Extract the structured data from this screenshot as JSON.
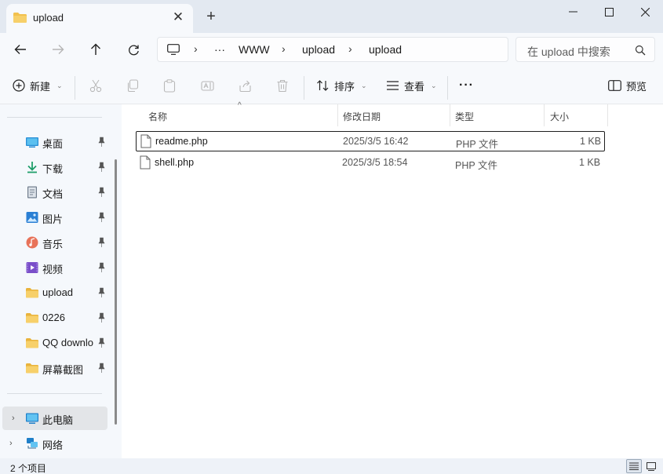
{
  "tab": {
    "title": "upload",
    "close_glyph": "✕",
    "new_glyph": "+"
  },
  "address": {
    "crumbs": [
      "···",
      "WWW",
      "upload",
      "upload"
    ],
    "sep": "›"
  },
  "search": {
    "placeholder": "在 upload 中搜索"
  },
  "toolbar": {
    "new_label": "新建",
    "sort_label": "排序",
    "view_label": "查看",
    "more_label": "···",
    "preview_label": "预览",
    "chev": "⌄"
  },
  "sidebar": {
    "items": [
      {
        "label": "桌面",
        "icon": "desktop-icon"
      },
      {
        "label": "下载",
        "icon": "download-icon"
      },
      {
        "label": "文档",
        "icon": "document-icon"
      },
      {
        "label": "图片",
        "icon": "pictures-icon"
      },
      {
        "label": "音乐",
        "icon": "music-icon"
      },
      {
        "label": "视频",
        "icon": "video-icon"
      },
      {
        "label": "upload",
        "icon": "folder-icon"
      },
      {
        "label": "0226",
        "icon": "folder-icon"
      },
      {
        "label": "QQ downlo",
        "icon": "folder-icon"
      },
      {
        "label": "屏幕截图",
        "icon": "folder-icon"
      }
    ],
    "this_pc": "此电脑",
    "network": "网络",
    "expander": "›"
  },
  "columns": {
    "name": "名称",
    "modified": "修改日期",
    "type": "类型",
    "size": "大小",
    "sort_glyph": "^"
  },
  "files": [
    {
      "name": "readme.php",
      "modified": "2025/3/5 16:42",
      "type": "PHP 文件",
      "size": "1 KB"
    },
    {
      "name": "shell.php",
      "modified": "2025/3/5 18:54",
      "type": "PHP 文件",
      "size": "1 KB"
    }
  ],
  "status": {
    "count": "2 个项目"
  },
  "colors": {
    "accent": "#0067c0",
    "folder": "#f2c14e",
    "titlebar": "#e3e9f1"
  }
}
